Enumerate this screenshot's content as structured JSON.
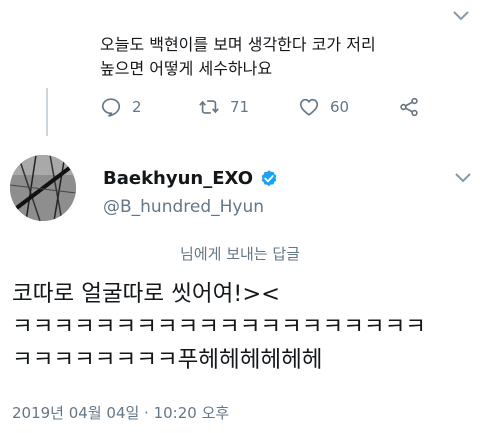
{
  "previous_tweet": {
    "text_line1": "오늘도 백현이를 보며 생각한다 코가 저리",
    "text_line2": "높으면 어떻게 세수하나요",
    "reply_count": "2",
    "retweet_count": "71",
    "like_count": "60"
  },
  "reply_tweet": {
    "display_name": "Baekhyun_EXO",
    "handle": "@B_hundred_Hyun",
    "replying_to": "님에게 보내는 답글",
    "text_line1": "코따로 얼굴따로 씻어여!><",
    "text_line2": "ㅋㅋㅋㅋㅋㅋㅋㅋㅋㅋㅋㅋㅋㅋㅋㅋㅋㅋㅋㅋ",
    "text_line3": "ㅋㅋㅋㅋㅋㅋㅋㅋ푸헤헤헤헤헤헤",
    "timestamp": "2019년 04월 04일 · 10:20 오후"
  },
  "colors": {
    "text": "#14171a",
    "secondary": "#657786",
    "verified": "#1da1f2"
  },
  "icons": {
    "reply": "reply-icon",
    "retweet": "retweet-icon",
    "like": "heart-icon",
    "share": "share-icon",
    "verified": "verified-badge-icon",
    "more": "chevron-down-icon"
  }
}
